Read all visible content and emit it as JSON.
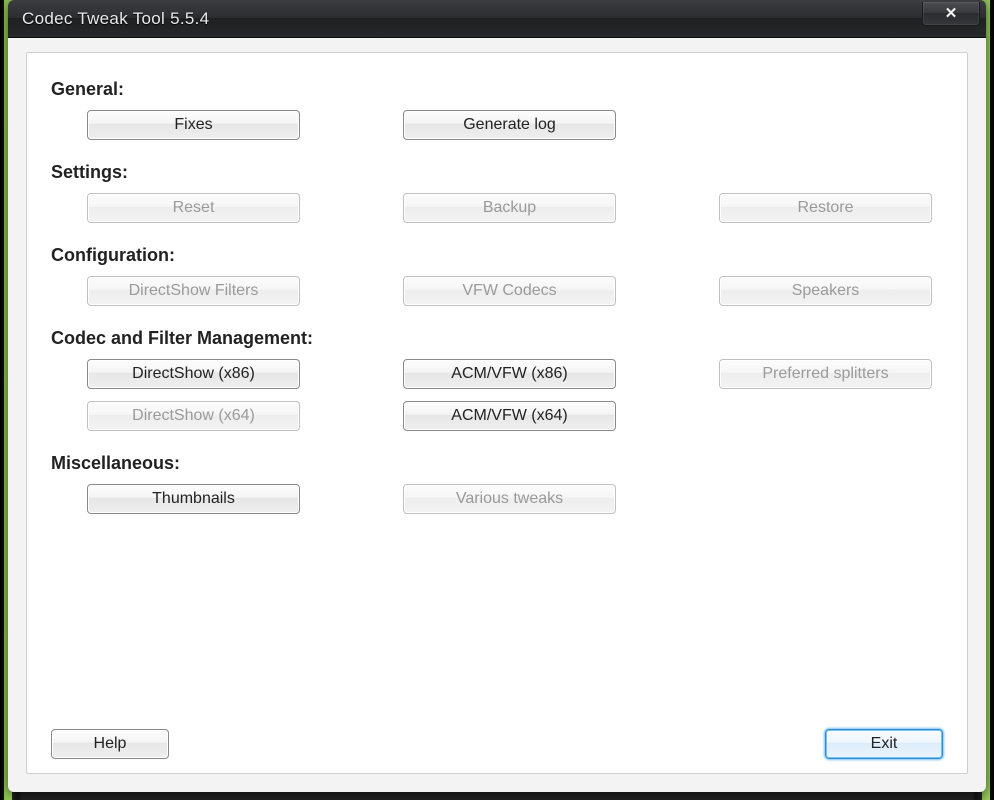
{
  "window": {
    "title": "Codec Tweak Tool 5.5.4",
    "close_glyph": "✕"
  },
  "sections": {
    "general": {
      "label": "General:",
      "fixes": "Fixes",
      "generate_log": "Generate log"
    },
    "settings": {
      "label": "Settings:",
      "reset": "Reset",
      "backup": "Backup",
      "restore": "Restore"
    },
    "configuration": {
      "label": "Configuration:",
      "directshow_filters": "DirectShow Filters",
      "vfw_codecs": "VFW Codecs",
      "speakers": "Speakers"
    },
    "codec_filter": {
      "label": "Codec and Filter Management:",
      "directshow_x86": "DirectShow  (x86)",
      "acmvfw_x86": "ACM/VFW  (x86)",
      "preferred_splitters": "Preferred splitters",
      "directshow_x64": "DirectShow  (x64)",
      "acmvfw_x64": "ACM/VFW  (x64)"
    },
    "misc": {
      "label": "Miscellaneous:",
      "thumbnails": "Thumbnails",
      "various_tweaks": "Various tweaks"
    }
  },
  "footer": {
    "help": "Help",
    "exit": "Exit"
  }
}
